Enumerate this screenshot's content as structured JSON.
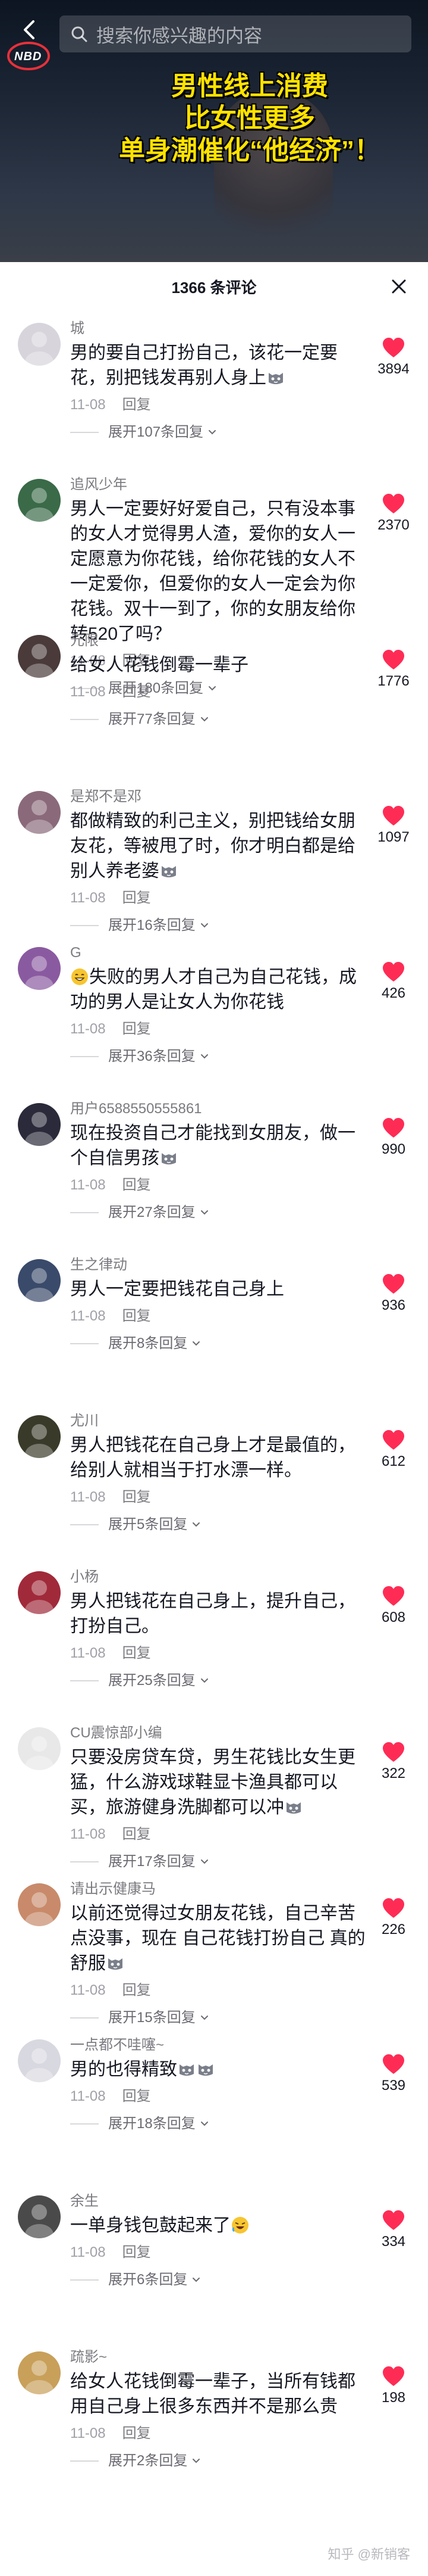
{
  "search": {
    "placeholder": "搜索你感兴趣的内容"
  },
  "video": {
    "logo_text": "NBD",
    "headline_lines": [
      "男性线上消费",
      "比女性更多",
      "单身潮催化“他经济”！"
    ]
  },
  "panel": {
    "title": "1366 条评论"
  },
  "colors": {
    "like_red": "#fe2c55",
    "headline_yellow": "#ffe200",
    "meta_gray": "#a0a0a8"
  },
  "comments": [
    {
      "username": "城",
      "text": "男的要自己打扮自己，该花一定要花，别把钱发再别人身上",
      "emoji": "cat-face",
      "date": "11-08",
      "reply_label": "回复",
      "expand": "展开107条回复",
      "likes": "3894",
      "avatar_color": "#d8d4dc"
    },
    {
      "username": "追风少年",
      "text": "男人一定要好好爱自己，只有没本事的女人才觉得男人渣，爱你的女人一定愿意为你花钱，给你花钱的女人不一定爱你，但爱你的女人一定会为你花钱。双十一到了，你的女朋友给你转520了吗？",
      "emoji": "",
      "date": "11-08",
      "reply_label": "回复",
      "expand": "展开180条回复",
      "likes": "2370",
      "avatar_color": "#3a6a48"
    },
    {
      "username": "元限",
      "text": "给女人花钱倒霉一辈子",
      "emoji": "",
      "date": "11-08",
      "reply_label": "回复",
      "expand": "展开77条回复",
      "likes": "1776",
      "avatar_color": "#4a3a3a"
    },
    {
      "username": "是郑不是邓",
      "text": "都做精致的利己主义，别把钱给女朋友花，等被甩了时，你才明白都是给别人养老婆",
      "emoji": "cat-face",
      "date": "11-08",
      "reply_label": "回复",
      "expand": "展开16条回复",
      "likes": "1097",
      "avatar_color": "#8a6a7a"
    },
    {
      "username": "G",
      "text": "失败的男人才自己为自己花钱，成功的男人是让女人为你花钱",
      "emoji": "grin-face",
      "date": "11-08",
      "reply_label": "回复",
      "expand": "展开36条回复",
      "likes": "426",
      "avatar_color": "#8a5aa0"
    },
    {
      "username": "用户6588550555861",
      "text": "现在投资自己才能找到女朋友，做一个自信男孩",
      "emoji": "cat-face",
      "date": "11-08",
      "reply_label": "回复",
      "expand": "展开27条回复",
      "likes": "990",
      "avatar_color": "#2a2a3a"
    },
    {
      "username": "生之律动",
      "text": "男人一定要把钱花自己身上",
      "emoji": "",
      "date": "11-08",
      "reply_label": "回复",
      "expand": "展开8条回复",
      "likes": "936",
      "avatar_color": "#3a4a6a"
    },
    {
      "username": "尤川",
      "text": "男人把钱花在自己身上才是最值的，给别人就相当于打水漂一样。",
      "emoji": "",
      "date": "11-08",
      "reply_label": "回复",
      "expand": "展开5条回复",
      "likes": "612",
      "avatar_color": "#3a3a2a"
    },
    {
      "username": "小杨",
      "text": "男人把钱花在自己身上，提升自己，打扮自己。",
      "emoji": "",
      "date": "11-08",
      "reply_label": "回复",
      "expand": "展开25条回复",
      "likes": "608",
      "avatar_color": "#a02a3a"
    },
    {
      "username": "CU震惊部小编",
      "text": "只要没房贷车贷，男生花钱比女生更猛，什么游戏球鞋显卡渔具都可以买，旅游健身洗脚都可以冲",
      "emoji": "cat-face",
      "date": "11-08",
      "reply_label": "回复",
      "expand": "展开17条回复",
      "likes": "322",
      "avatar_color": "#e8e8e8"
    },
    {
      "username": "请出示健康马",
      "text": "以前还觉得过女朋友花钱，自己辛苦点没事，现在 自己花钱打扮自己 真的舒服",
      "emoji": "cat-face",
      "date": "11-08",
      "reply_label": "回复",
      "expand": "展开15条回复",
      "likes": "226",
      "avatar_color": "#c88a6a"
    },
    {
      "username": "一点都不哇噻~",
      "text": "男的也得精致",
      "emoji": "cat-face-double",
      "date": "11-08",
      "reply_label": "回复",
      "expand": "展开18条回复",
      "likes": "539",
      "avatar_color": "#d8d8e0"
    },
    {
      "username": "余生",
      "text": "一单身钱包鼓起来了",
      "emoji": "laugh-face",
      "date": "11-08",
      "reply_label": "回复",
      "expand": "展开6条回复",
      "likes": "334",
      "avatar_color": "#4a4a4a"
    },
    {
      "username": "疏影~",
      "text": "给女人花钱倒霉一辈子，当所有钱都用自己身上很多东西并不是那么贵",
      "emoji": "",
      "date": "11-08",
      "reply_label": "回复",
      "expand": "展开2条回复",
      "likes": "198",
      "avatar_color": "#c8a05a"
    }
  ],
  "watermark": "知乎 @新销客"
}
